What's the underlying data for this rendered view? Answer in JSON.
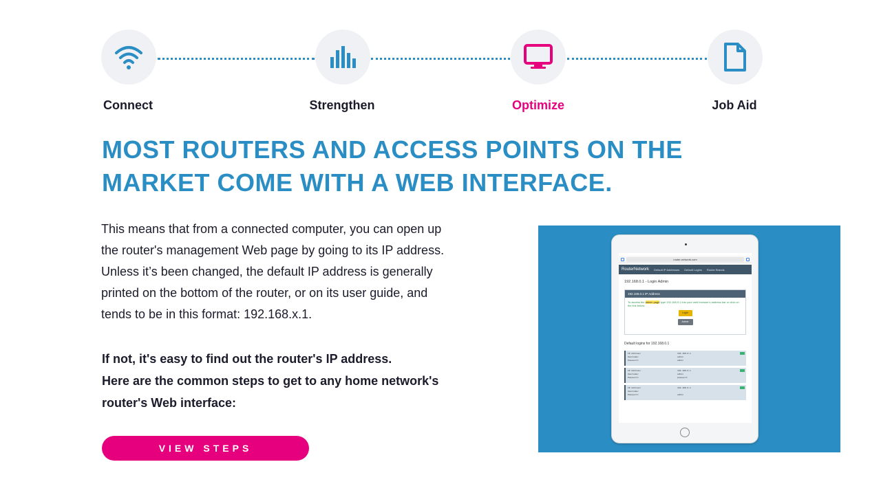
{
  "stepper": {
    "steps": [
      {
        "label": "Connect",
        "icon": "wifi-icon",
        "active": false
      },
      {
        "label": "Strengthen",
        "icon": "signal-bars-icon",
        "active": false
      },
      {
        "label": "Optimize",
        "icon": "monitor-icon",
        "active": true
      },
      {
        "label": "Job Aid",
        "icon": "document-icon",
        "active": false
      }
    ]
  },
  "headline": "MOST ROUTERS AND ACCESS POINTS ON THE MARKET COME WITH A WEB INTERFACE.",
  "body": {
    "lines": [
      "This means that from a connected computer, you can open up",
      "the router's management Web page by going to its IP address.",
      "Unless it’s been changed, the default IP address is generally",
      "printed on the bottom of the router, or on its user guide, and",
      "tends to be in this format: 192.168.x.1."
    ]
  },
  "steps_intro": {
    "lines": [
      "If not, it's easy to find out the router's IP address.",
      "Here are the common steps to get to any home network's",
      "router's Web interface:"
    ]
  },
  "cta": {
    "label": "VIEW STEPS"
  },
  "tablet": {
    "url": "router-network.com",
    "brand": "RouterNetwork",
    "nav": [
      "Default IP Addresses",
      "Default Logins",
      "Router Brands"
    ],
    "page_title": "192.168.0.1 - Login Admin",
    "panel_title": "192.168.0.1 IP Address",
    "panel_text_pre": "To access the ",
    "panel_text_mark": "admin page",
    "panel_text_post": " type 192.168.0.1 into your web browser's address bar or click on the link below.",
    "login_label": "Login",
    "admin_label": "Admin",
    "logins_title": "Default logins for 192.168.0.1",
    "rows": [
      {
        "ip": "192.168.0.1",
        "user": "admin",
        "pass": "admin"
      },
      {
        "ip": "192.168.0.1",
        "user": "admin",
        "pass": "password"
      },
      {
        "ip": "192.168.0.1",
        "user": "",
        "pass": "admin"
      }
    ],
    "row_keys": {
      "ip": "IP Address:",
      "user": "Username:",
      "pass": "Password:"
    }
  },
  "colors": {
    "accent_blue": "#2a8ec4",
    "accent_pink": "#e6007e",
    "text_dark": "#1b1b2b",
    "circle_bg": "#f0f1f4"
  }
}
